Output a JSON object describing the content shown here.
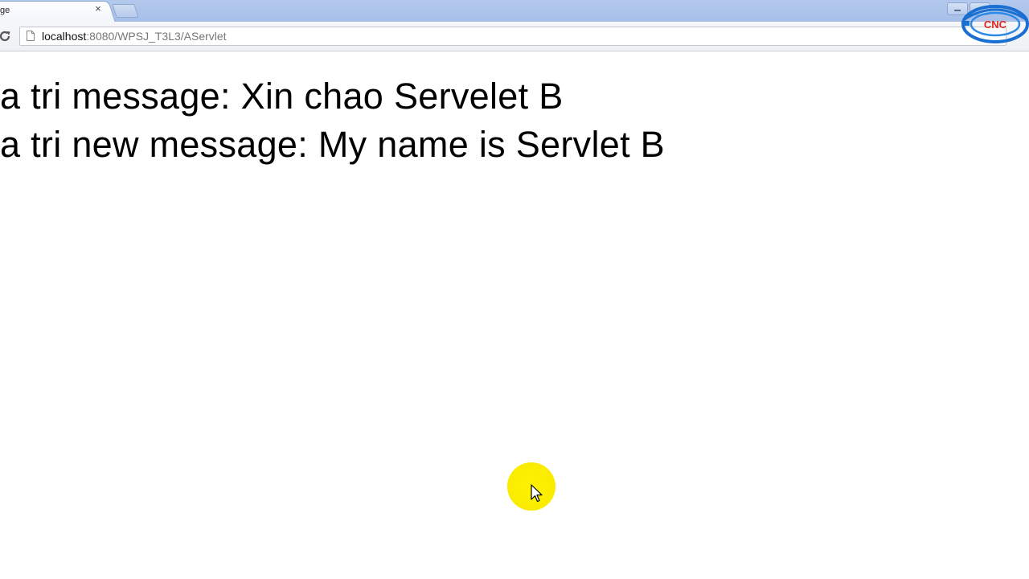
{
  "browser": {
    "tab": {
      "title": "ge",
      "close_glyph": "×"
    },
    "address": {
      "host": "localhost",
      "path": ":8080/WPSJ_T3L3/AServlet"
    },
    "icons": {
      "reload": "reload-icon",
      "page": "page-icon",
      "minimize": "minimize-icon",
      "maximize": "maximize-icon"
    }
  },
  "page": {
    "lines": [
      "a tri message: Xin chao Servelet B",
      "a tri new message: My name is Servlet B"
    ]
  },
  "overlay": {
    "logo_text": "CNC",
    "cursor_highlight_color": "#fff200"
  },
  "colors": {
    "tabstrip": "#a7bfe8",
    "logo_blue": "#1a6fd1",
    "logo_red": "#e2261d"
  }
}
